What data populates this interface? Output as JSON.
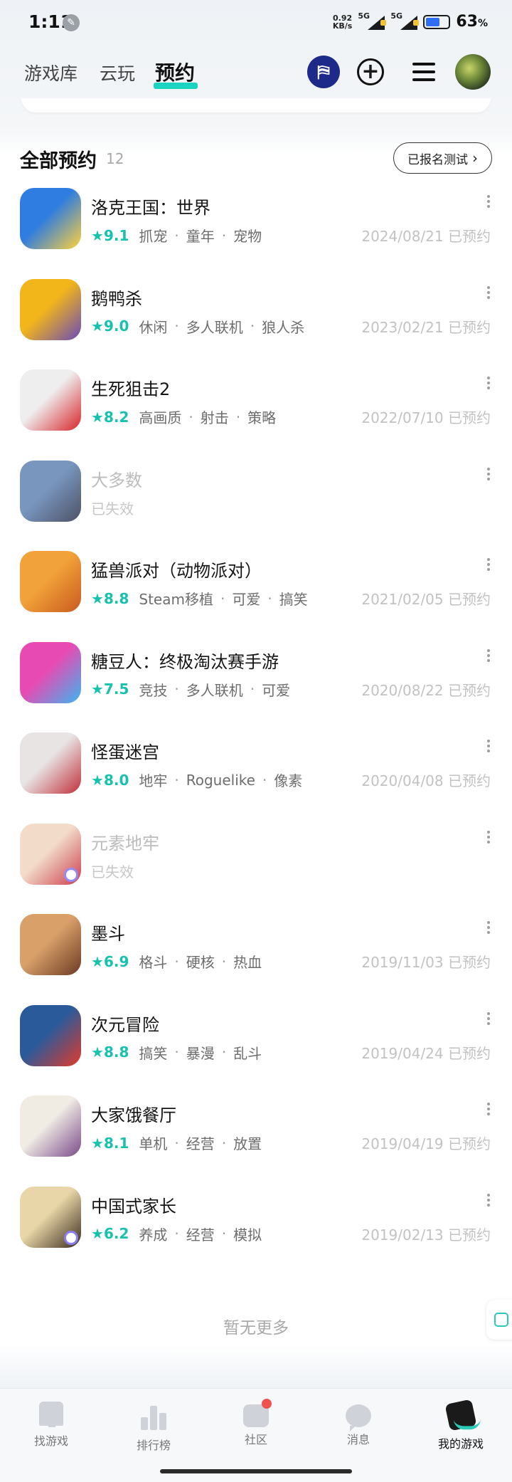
{
  "status_bar": {
    "time": "1:11",
    "net_speed_value": "0.92",
    "net_speed_unit": "KB/s",
    "sim1": "5G",
    "sim2": "5G",
    "battery_percent": "63",
    "battery_unit": "%"
  },
  "header": {
    "tabs": [
      {
        "label": "游戏库",
        "active": false
      },
      {
        "label": "云玩",
        "active": false
      },
      {
        "label": "预约",
        "active": true
      }
    ],
    "icons": [
      "gift-icon",
      "plus-icon",
      "menu-icon",
      "avatar"
    ]
  },
  "section": {
    "title": "全部预约",
    "count": "12",
    "registered_button": "已报名测试"
  },
  "games": [
    {
      "name": "洛克王国：世界",
      "rating": "9.1",
      "tags": [
        "抓宠",
        "童年",
        "宠物"
      ],
      "date": "2024/08/21 已预约",
      "expired": false,
      "colors": [
        "#2f7de0",
        "#ffd23a"
      ]
    },
    {
      "name": "鹅鸭杀",
      "rating": "9.0",
      "tags": [
        "休闲",
        "多人联机",
        "狼人杀"
      ],
      "date": "2023/02/21 已预约",
      "expired": false,
      "colors": [
        "#f2b51a",
        "#6a4ab8"
      ]
    },
    {
      "name": "生死狙击2",
      "rating": "8.2",
      "tags": [
        "高画质",
        "射击",
        "策略"
      ],
      "date": "2022/07/10 已预约",
      "expired": false,
      "colors": [
        "#eeeeee",
        "#d8242a"
      ]
    },
    {
      "name": "大多数",
      "rating": "",
      "tags": [],
      "status": "已失效",
      "date": "",
      "expired": true,
      "colors": [
        "#6b8bb8",
        "#3a3f55"
      ]
    },
    {
      "name": "猛兽派对（动物派对）",
      "rating": "8.8",
      "tags": [
        "Steam移植",
        "可爱",
        "搞笑"
      ],
      "date": "2021/02/05 已预约",
      "expired": false,
      "colors": [
        "#f2a23a",
        "#c95a1e"
      ]
    },
    {
      "name": "糖豆人：终极淘汰赛手游",
      "rating": "7.5",
      "tags": [
        "竞技",
        "多人联机",
        "可爱"
      ],
      "date": "2020/08/22 已预约",
      "expired": false,
      "colors": [
        "#e84ab3",
        "#3ab6f0"
      ]
    },
    {
      "name": "怪蛋迷宫",
      "rating": "8.0",
      "tags": [
        "地牢",
        "Roguelike",
        "像素"
      ],
      "date": "2020/04/08 已预约",
      "expired": false,
      "colors": [
        "#e8e4e4",
        "#c0303a"
      ]
    },
    {
      "name": "元素地牢",
      "rating": "",
      "tags": [],
      "status": "已失效",
      "date": "",
      "expired": true,
      "colors": [
        "#f1d9c4",
        "#c8283a"
      ],
      "badge": true
    },
    {
      "name": "墨斗",
      "rating": "6.9",
      "tags": [
        "格斗",
        "硬核",
        "热血"
      ],
      "date": "2019/11/03 已预约",
      "expired": false,
      "colors": [
        "#d9a06a",
        "#6b3a22"
      ]
    },
    {
      "name": "次元冒险",
      "rating": "8.8",
      "tags": [
        "搞笑",
        "暴漫",
        "乱斗"
      ],
      "date": "2019/04/24 已预约",
      "expired": false,
      "colors": [
        "#2a5a9a",
        "#e23a2a"
      ]
    },
    {
      "name": "大家饿餐厅",
      "rating": "8.1",
      "tags": [
        "单机",
        "经营",
        "放置"
      ],
      "date": "2019/04/19 已预约",
      "expired": false,
      "colors": [
        "#f0ece4",
        "#7a4a8a"
      ]
    },
    {
      "name": "中国式家长",
      "rating": "6.2",
      "tags": [
        "养成",
        "经营",
        "模拟"
      ],
      "date": "2019/02/13 已预约",
      "expired": false,
      "colors": [
        "#e8d6a8",
        "#3a2a1a"
      ],
      "badge": true
    }
  ],
  "footer": {
    "no_more": "暂无更多"
  },
  "bottom_nav": [
    {
      "label": "找游戏",
      "icon": "hammer-icon",
      "active": false
    },
    {
      "label": "排行榜",
      "icon": "ranking-icon",
      "active": false
    },
    {
      "label": "社区",
      "icon": "community-icon",
      "active": false,
      "has_dot": true
    },
    {
      "label": "消息",
      "icon": "message-icon",
      "active": false
    },
    {
      "label": "我的游戏",
      "icon": "gamepad-icon",
      "active": true
    }
  ]
}
